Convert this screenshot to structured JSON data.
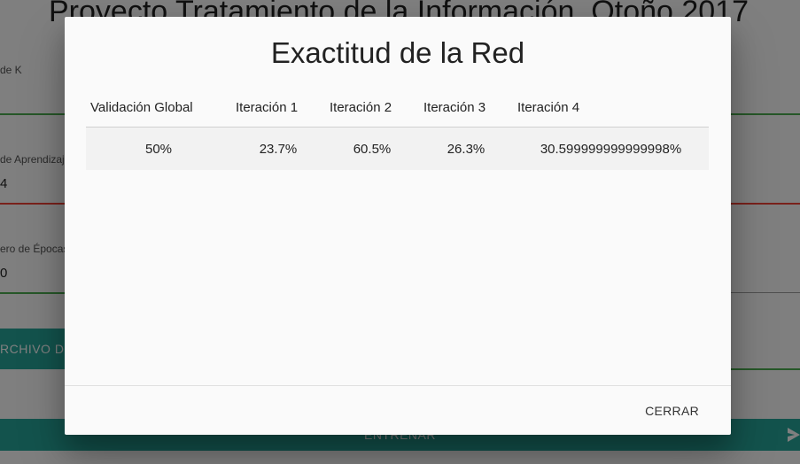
{
  "background": {
    "title": "Proyecto Tratamiento de la Información. Otoño 2017",
    "fields": [
      {
        "label": "de K",
        "value": ""
      },
      {
        "label": "de Aprendizaj",
        "value": "4"
      },
      {
        "label": "ero de Épocas",
        "value": "0"
      }
    ],
    "file_button_label": "RCHIVO DE",
    "train_button_label": "ENTRENAR",
    "send_icon": "send-icon",
    "accent_color": "#26a69a"
  },
  "modal": {
    "title": "Exactitud de la Red",
    "table": {
      "headers": [
        "Validación Global",
        "Iteración 1",
        "Iteración 2",
        "Iteración 3",
        "Iteración 4"
      ],
      "rows": [
        [
          "50%",
          "23.7%",
          "60.5%",
          "26.3%",
          "30.599999999999998%"
        ]
      ]
    },
    "close_label": "CERRAR"
  }
}
